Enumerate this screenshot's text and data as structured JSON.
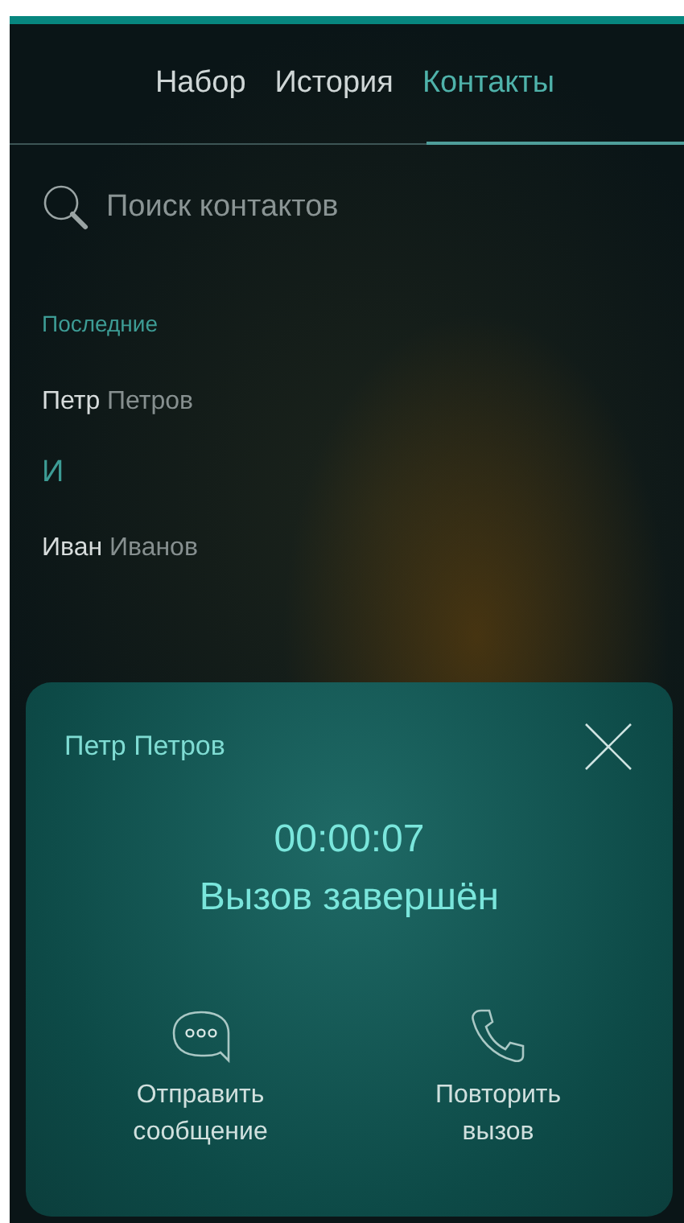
{
  "tabs": [
    {
      "label": "Набор",
      "selected": false
    },
    {
      "label": "История",
      "selected": false
    },
    {
      "label": "Контакты",
      "selected": true
    }
  ],
  "search": {
    "placeholder": "Поиск контактов"
  },
  "contacts": [
    {
      "kind": "header",
      "text": "Последние"
    },
    {
      "kind": "contact",
      "first": "Петр",
      "last": "Петров"
    },
    {
      "kind": "header",
      "text": "И"
    },
    {
      "kind": "contact",
      "first": "Иван",
      "last": "Иванов"
    }
  ],
  "call_card": {
    "name": "Петр Петров",
    "duration": "00:00:07",
    "status": "Вызов завершён",
    "actions": [
      {
        "kind": "message",
        "label": "Отправить сообщение"
      },
      {
        "kind": "call",
        "label": "Повторить вызов"
      }
    ]
  }
}
